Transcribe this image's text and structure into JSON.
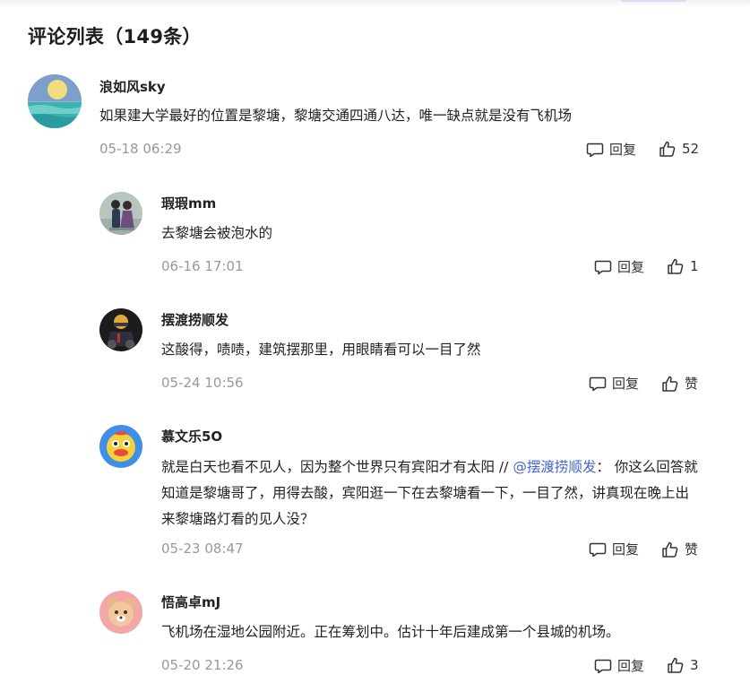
{
  "page": {
    "title": "评论列表（149条）"
  },
  "comments": [
    {
      "user": "浪如风sky",
      "text": "如果建大学最好的位置是黎塘，黎塘交通四通八达，唯一缺点就是没有飞机场",
      "time": "05-18 06:29",
      "reply_label": "回复",
      "like_label": "52",
      "avatar_icon": "moon-sea-avatar"
    },
    {
      "user": "瑕瑕mm",
      "text": "去黎塘会被泡水的",
      "time": "06-16 17:01",
      "reply_label": "回复",
      "like_label": "1",
      "avatar_icon": "couple-avatar"
    },
    {
      "user": "摆渡捞顺发",
      "text": "这酸得，啧啧，建筑摆那里，用眼睛看可以一目了然",
      "time": "05-24 10:56",
      "reply_label": "回复",
      "like_label": "赞",
      "avatar_icon": "rider-avatar"
    },
    {
      "user": "慕文乐5O",
      "text_prefix": "就是白天也看不见人，因为整个世界只有宾阳才有太阳 //",
      "mention": "@摆渡捞顺发",
      "text_suffix": "： 你这么回答就知道是黎塘哥了，用得去酸，宾阳逛一下在去黎塘看一下，一目了然，讲真现在晚上出来黎塘路灯看的见人没？",
      "time": "05-23 08:47",
      "reply_label": "回复",
      "like_label": "赞",
      "avatar_icon": "duck-avatar"
    },
    {
      "user": "悟高卓mJ",
      "text": "飞机场在湿地公园附近。正在筹划中。估计十年后建成第一个县城的机场。",
      "time": "05-20 21:26",
      "reply_label": "回复",
      "like_label": "3",
      "avatar_icon": "bear-avatar"
    }
  ],
  "colors": {
    "mention": "#4566c9",
    "muted": "#999999",
    "text": "#222222"
  }
}
